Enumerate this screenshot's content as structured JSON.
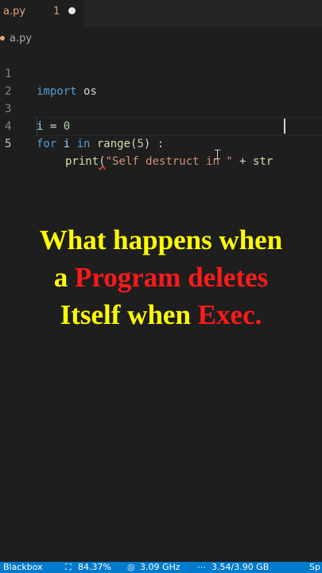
{
  "tab": {
    "filename": "a.py",
    "problems_count": "1"
  },
  "breadcrumb": {
    "file": "a.py"
  },
  "editor": {
    "line_numbers": [
      "1",
      "2",
      "3",
      "4",
      "5"
    ],
    "line1": {
      "kw": "import",
      "rest": " os"
    },
    "line3": {
      "var": "i",
      "op": " = ",
      "num": "0"
    },
    "line4": {
      "kw": "for",
      "var": " i ",
      "kw2": "in",
      "fn": " range",
      "open": "(",
      "num": "5",
      "close": ")",
      "colon": " :"
    },
    "line5": {
      "fn": "print",
      "paren": "(",
      "str": "\"Self destruct in \"",
      "op": " + ",
      "fn2": "str"
    }
  },
  "caption": {
    "part1": "What happens when",
    "part2a": "a ",
    "part2b": "Program deletes",
    "part3a": "Itself when ",
    "part3b": "Exec."
  },
  "statusbar": {
    "item1": "Blackbox",
    "item2": "84.37%",
    "item3": "3.09 GHz",
    "item4": "3.54/3.90 GB",
    "item5": "Sp"
  },
  "colors": {
    "accent": "#007acc",
    "caption_yellow": "#ffff00",
    "caption_red": "#ff1a1a"
  }
}
